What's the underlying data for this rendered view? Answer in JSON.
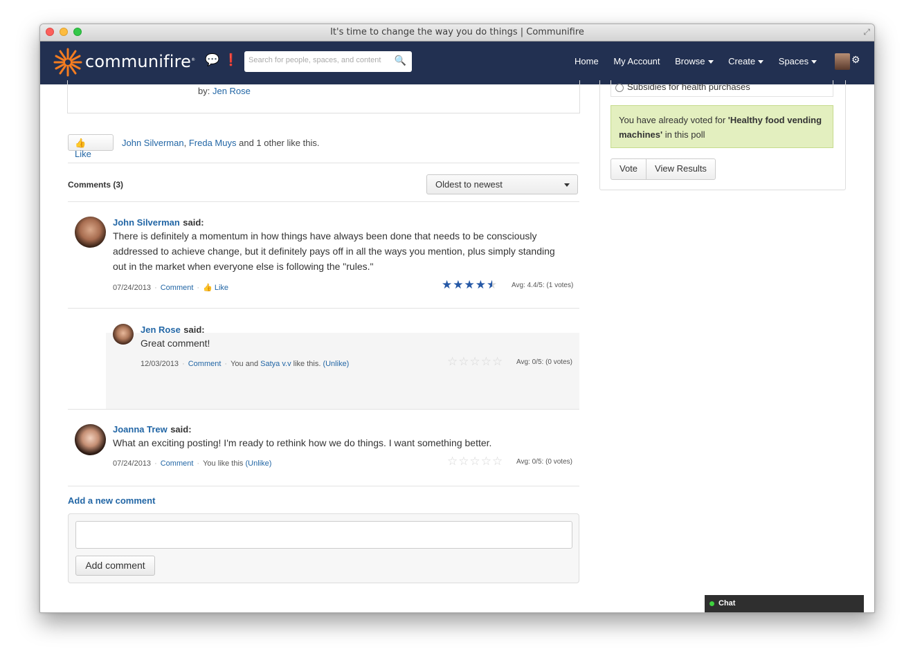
{
  "window": {
    "title": "It's time to change the way you do things | Communifire"
  },
  "navbar": {
    "brand": "communifire",
    "search_placeholder": "Search for people, spaces, and content",
    "menu": [
      {
        "label": "Home",
        "dropdown": false
      },
      {
        "label": "My Account",
        "dropdown": false
      },
      {
        "label": "Browse",
        "dropdown": true
      },
      {
        "label": "Create",
        "dropdown": true
      },
      {
        "label": "Spaces",
        "dropdown": true
      }
    ],
    "colors": {
      "navbar_bg": "#223051",
      "logo_accent": "#f47c20"
    }
  },
  "post": {
    "by_label": "by:",
    "author": "Jen Rose",
    "like_label": "Like",
    "likers": [
      "John Silverman",
      "Freda Muys"
    ],
    "likes_suffix": "and 1 other like this."
  },
  "comments": {
    "title": "Comments (3)",
    "sort_selected": "Oldest to newest",
    "items": [
      {
        "author": "John Silverman",
        "said": "said:",
        "text": "There is definitely a momentum in how things have always been done that needs to be consciously addressed to achieve change, but it definitely pays off in all the ways you mention, plus simply standing out in the market when everyone else is following the \"rules.\"",
        "date": "07/24/2013",
        "comment_link": "Comment",
        "like_link": "Like",
        "rating": 4.4,
        "avg": "Avg: 4.4/5: (1 votes)"
      },
      {
        "author": "Jen Rose",
        "said": "said:",
        "text": "Great comment!",
        "date": "12/03/2013",
        "comment_link": "Comment",
        "likes_prefix": "You and",
        "liker": "Satya v.v",
        "likes_suffix": "like this.",
        "unlike": "(Unlike)",
        "rating": 0,
        "avg": "Avg: 0/5: (0 votes)"
      },
      {
        "author": "Joanna Trew",
        "said": "said:",
        "text": "What an exciting posting! I'm ready to rethink how we do things. I want something better.",
        "date": "07/24/2013",
        "comment_link": "Comment",
        "likes_text": "You like this",
        "unlike": "(Unlike)",
        "rating": 0,
        "avg": "Avg: 0/5: (0 votes)"
      }
    ],
    "add_title": "Add a new comment",
    "add_button": "Add comment"
  },
  "poll": {
    "option": "Subsidies for health purchases",
    "voted_prefix": "You have already voted for ",
    "voted_choice": "'Healthy food vending machines'",
    "voted_suffix": " in this poll",
    "vote_button": "Vote",
    "results_button": "View Results"
  },
  "chat": {
    "label": "Chat",
    "status_color": "#3fd23f"
  }
}
